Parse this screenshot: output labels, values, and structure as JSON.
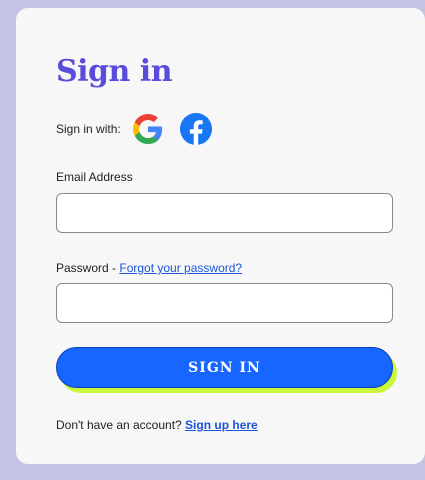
{
  "form": {
    "title": "Sign in",
    "social_label": "Sign in with:",
    "social": [
      {
        "name": "google-icon",
        "color": "#4285F4"
      },
      {
        "name": "facebook-icon",
        "color": "#1877F2"
      }
    ],
    "email_label": "Email Address",
    "email_value": "",
    "password_label": "Password - ",
    "forgot_link": "Forgot your password?",
    "password_value": "",
    "submit_label": "SIGN IN",
    "footer_text": "Don't have an account? ",
    "signup_link": "Sign up here"
  },
  "colors": {
    "background": "#c3c4e3",
    "title": "#5a4cdb",
    "button": "#1666ff",
    "button_shadow": "#c9f73a",
    "link": "#1a56d9"
  }
}
